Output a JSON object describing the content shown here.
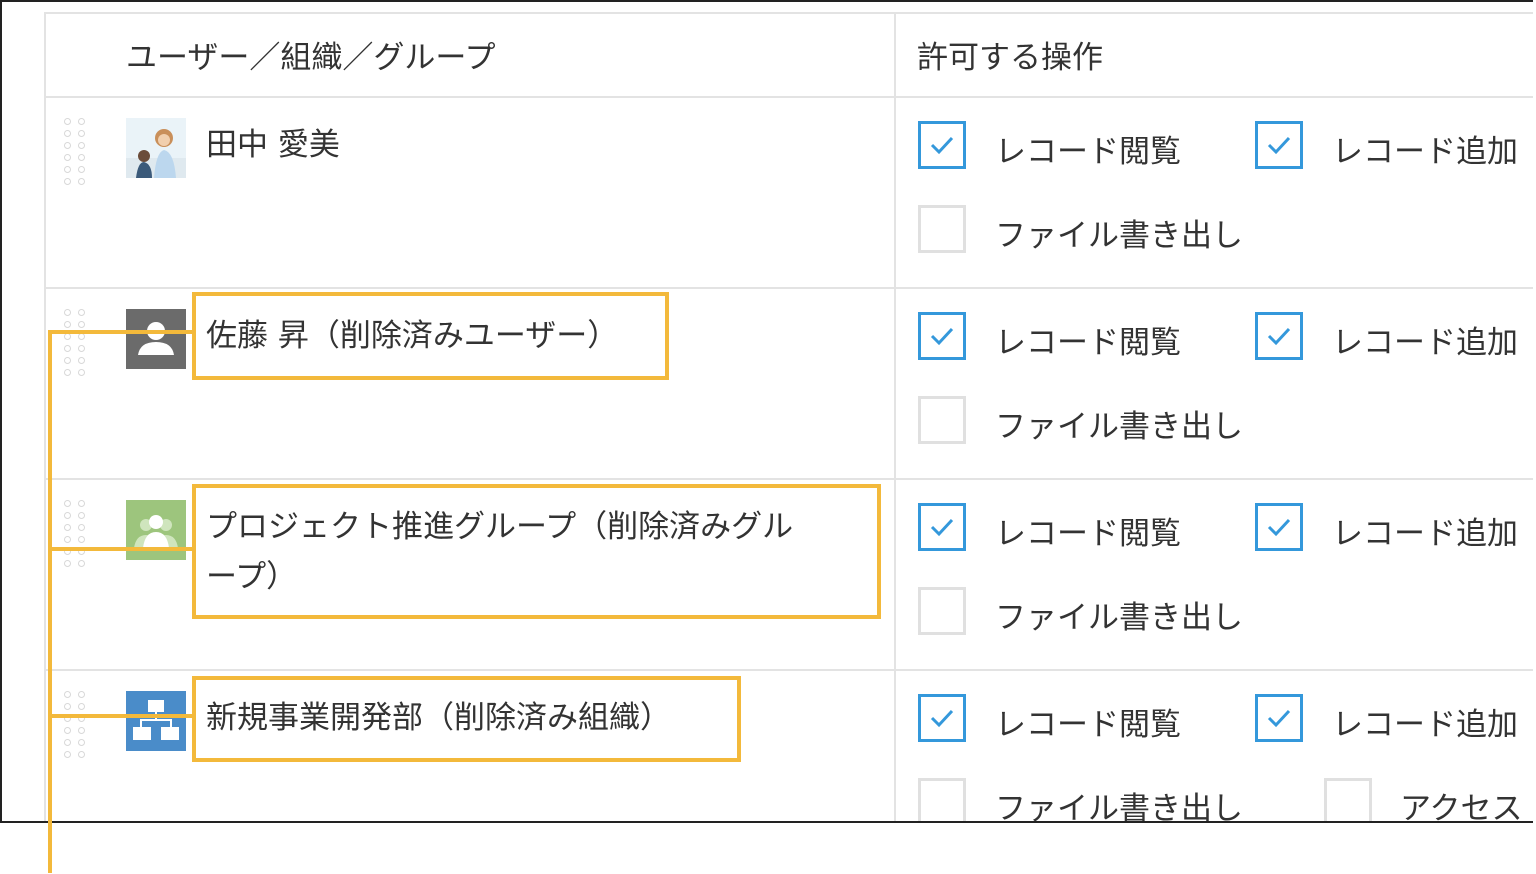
{
  "header": {
    "col_entity": "ユーザー／組織／グループ",
    "col_permissions": "許可する操作"
  },
  "permission_labels": {
    "view": "レコード閲覧",
    "add": "レコード追加",
    "export": "ファイル書き出し",
    "access": "アクセス"
  },
  "rows": [
    {
      "name": "田中 愛美",
      "type": "user-photo",
      "view": true,
      "add": true,
      "export": false
    },
    {
      "name": "佐藤 昇（削除済みユーザー）",
      "type": "deleted-user",
      "view": true,
      "add": true,
      "export": false
    },
    {
      "name": "プロジェクト推進グループ（削除済みグループ）",
      "name_line1": "プロジェクト推進グループ（削除済みグル",
      "name_line2": "ープ）",
      "type": "deleted-group",
      "view": true,
      "add": true,
      "export": false
    },
    {
      "name": "新規事業開発部（削除済み組織）",
      "type": "deleted-organization",
      "view": true,
      "add": true,
      "export": false,
      "access": false
    }
  ],
  "colors": {
    "checkbox_checked": "#3498db",
    "highlight": "#f3b93b",
    "deleted_user_icon": "#6b6b6b",
    "group_icon": "#9dc57d",
    "org_icon": "#4a8cc9"
  }
}
